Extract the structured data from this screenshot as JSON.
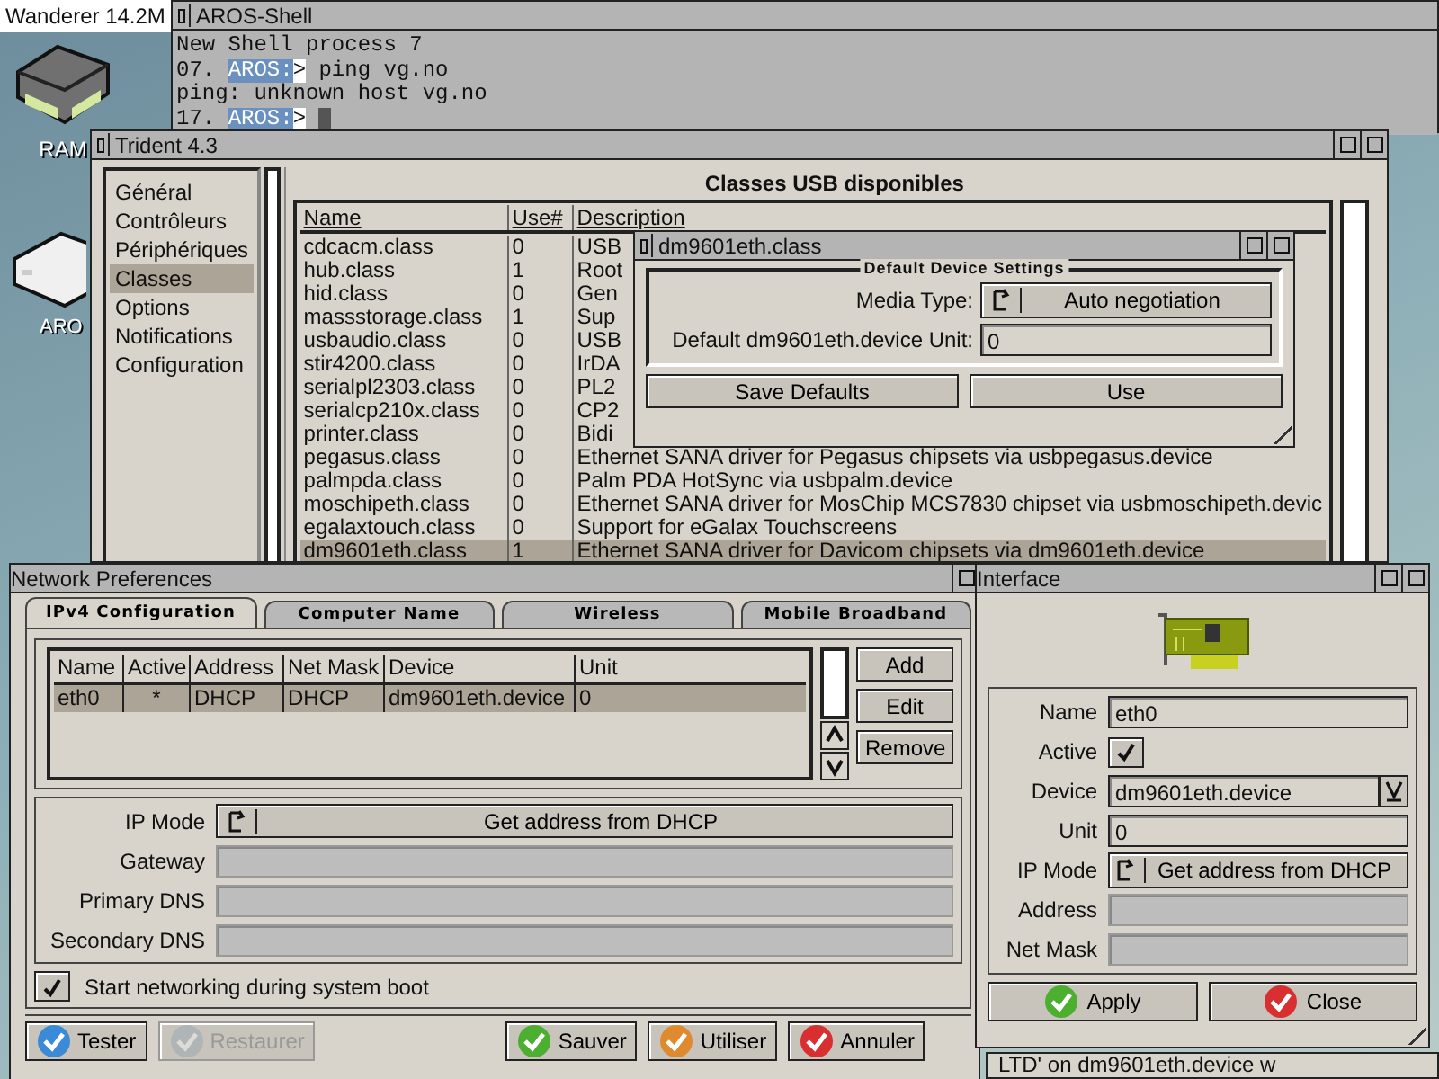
{
  "wanderer": {
    "title": "Wanderer 14.2M"
  },
  "desktop_icons": [
    {
      "kind": "ram",
      "label": "RAM"
    },
    {
      "kind": "disk",
      "label": "ARO"
    }
  ],
  "shell": {
    "title": "AROS-Shell",
    "lines": [
      {
        "kind": "output",
        "text": "New Shell process 7"
      },
      {
        "kind": "prompt",
        "number": "07.",
        "prompt": "AROS:",
        "sign": ">",
        "command": "ping vg.no"
      },
      {
        "kind": "output",
        "text": "ping: unknown host vg.no"
      },
      {
        "kind": "prompt",
        "number": "17.",
        "prompt": "AROS:",
        "sign": ">",
        "cursor": true
      }
    ]
  },
  "trident": {
    "title": "Trident 4.3",
    "nav": [
      {
        "label": "Général",
        "selected": false
      },
      {
        "label": "Contrôleurs",
        "selected": false
      },
      {
        "label": "Périphériques",
        "selected": false
      },
      {
        "label": "Classes",
        "selected": true
      },
      {
        "label": "Options",
        "selected": false
      },
      {
        "label": "Notifications",
        "selected": false
      },
      {
        "label": "Configuration",
        "selected": false
      }
    ],
    "heading": "Classes USB disponibles",
    "columns": [
      "Name",
      "Use#",
      "Description"
    ],
    "rows": [
      {
        "name": "cdcacm.class",
        "use": "0",
        "description": "USB",
        "selected": false
      },
      {
        "name": "hub.class",
        "use": "1",
        "description": "Root",
        "selected": false
      },
      {
        "name": "hid.class",
        "use": "0",
        "description": "Gen",
        "selected": false
      },
      {
        "name": "massstorage.class",
        "use": "1",
        "description": "Sup",
        "selected": false
      },
      {
        "name": "usbaudio.class",
        "use": "0",
        "description": "USB",
        "selected": false
      },
      {
        "name": "stir4200.class",
        "use": "0",
        "description": "IrDA",
        "selected": false
      },
      {
        "name": "serialpl2303.class",
        "use": "0",
        "description": "PL2",
        "selected": false
      },
      {
        "name": "serialcp210x.class",
        "use": "0",
        "description": "CP2",
        "selected": false
      },
      {
        "name": "printer.class",
        "use": "0",
        "description": "Bidi",
        "selected": false
      },
      {
        "name": "pegasus.class",
        "use": "0",
        "description": "Ethernet SANA driver for Pegasus chipsets via usbpegasus.device",
        "selected": false
      },
      {
        "name": "palmpda.class",
        "use": "0",
        "description": "Palm PDA HotSync via usbpalm.device",
        "selected": false
      },
      {
        "name": "moschipeth.class",
        "use": "0",
        "description": "Ethernet SANA driver for MosChip MCS7830 chipset via usbmoschipeth.devic",
        "selected": false
      },
      {
        "name": "egalaxtouch.class",
        "use": "0",
        "description": "Support for eGalax Touchscreens",
        "selected": false
      },
      {
        "name": "dm9601eth.class",
        "use": "1",
        "description": "Ethernet SANA driver for Davicom chipsets via dm9601eth.device",
        "selected": true
      }
    ]
  },
  "class_window": {
    "title": "dm9601eth.class",
    "group": "Default Device Settings",
    "media_label": "Media Type:",
    "media_value": "Auto negotiation",
    "unit_label": "Default dm9601eth.device Unit:",
    "unit_value": "0",
    "buttons": [
      "Save Defaults",
      "Use"
    ]
  },
  "network": {
    "title": "Network Preferences",
    "tabs": [
      {
        "label": "IPv4 Configuration",
        "selected": true
      },
      {
        "label": "Computer Name",
        "selected": false
      },
      {
        "label": "Wireless",
        "selected": false
      },
      {
        "label": "Mobile Broadband",
        "selected": false
      }
    ],
    "columns": [
      "Name",
      "Active",
      "Address",
      "Net Mask",
      "Device",
      "Unit"
    ],
    "rows": [
      {
        "cells": [
          "eth0",
          "*",
          "DHCP",
          "DHCP",
          "dm9601eth.device",
          "0"
        ],
        "selected": true
      }
    ],
    "list_buttons": [
      "Add",
      "Edit",
      "Remove"
    ],
    "ip_mode_label": "IP Mode",
    "ip_mode_value": "Get address from DHCP",
    "fields": [
      {
        "label": "Gateway",
        "disabled": true
      },
      {
        "label": "Primary DNS",
        "disabled": true
      },
      {
        "label": "Secondary DNS",
        "disabled": true
      }
    ],
    "boot_label": "Start networking during system boot",
    "boot_checked": true,
    "buttons": [
      {
        "kind": "test",
        "label": "Tester",
        "disabled": false
      },
      {
        "kind": "revert",
        "label": "Restaurer",
        "disabled": true
      },
      {
        "kind": "save",
        "label": "Sauver",
        "disabled": false
      },
      {
        "kind": "use",
        "label": "Utiliser",
        "disabled": false
      },
      {
        "kind": "cancel",
        "label": "Annuler",
        "disabled": false
      }
    ]
  },
  "interface": {
    "title": "Interface",
    "name_label": "Name",
    "name_value": "eth0",
    "active_label": "Active",
    "active_checked": true,
    "device_label": "Device",
    "device_value": "dm9601eth.device",
    "unit_label": "Unit",
    "unit_value": "0",
    "ip_mode_label": "IP Mode",
    "ip_mode_value": "Get address from DHCP",
    "address_label": "Address",
    "netmask_label": "Net Mask",
    "buttons": [
      {
        "kind": "apply",
        "label": "Apply"
      },
      {
        "kind": "close",
        "label": "Close"
      }
    ]
  },
  "background_text": "LTD' on dm9601eth.device w"
}
